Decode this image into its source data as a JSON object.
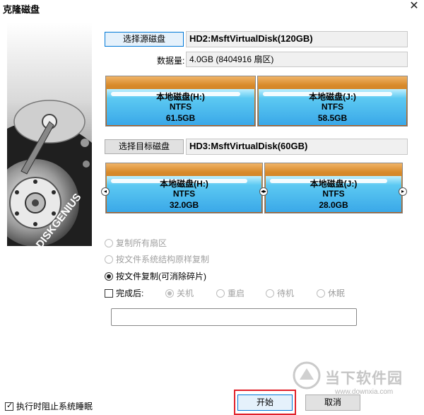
{
  "window": {
    "title": "克隆磁盘",
    "close_glyph": "✕"
  },
  "side_image": {
    "brand_text": "DISKGENIUS"
  },
  "source": {
    "button_label": "选择源磁盘",
    "disk_name": "HD2:MsftVirtualDisk(120GB)",
    "capacity_label": "数据量:",
    "capacity_value": "4.0GB (8404916 扇区)",
    "partitions": [
      {
        "name": "本地磁盘(H:)",
        "fs": "NTFS",
        "size": "61.5GB"
      },
      {
        "name": "本地磁盘(J:)",
        "fs": "NTFS",
        "size": "58.5GB"
      }
    ]
  },
  "target": {
    "button_label": "选择目标磁盘",
    "disk_name": "HD3:MsftVirtualDisk(60GB)",
    "partitions": [
      {
        "name": "本地磁盘(H:)",
        "fs": "NTFS",
        "size": "32.0GB"
      },
      {
        "name": "本地磁盘(J:)",
        "fs": "NTFS",
        "size": "28.0GB"
      }
    ]
  },
  "options": {
    "copy_all_sectors": "复制所有扇区",
    "copy_by_structure": "按文件系统结构原样复制",
    "copy_by_file": "按文件复制(可消除碎片)",
    "after_complete": "完成后:",
    "shutdown": "关机",
    "restart": "重启",
    "standby": "待机",
    "sleep": "休眠",
    "prevent_sleep": "执行时阻止系统睡眠"
  },
  "buttons": {
    "start": "开始",
    "cancel": "取消"
  },
  "watermark": {
    "name": "当下软件园",
    "url": "www.downxia.com"
  },
  "colors": {
    "partition_top": "#b05e1e",
    "partition_body": "#3aa8e8",
    "highlight": "#e0202a",
    "focus": "#0078d7"
  }
}
